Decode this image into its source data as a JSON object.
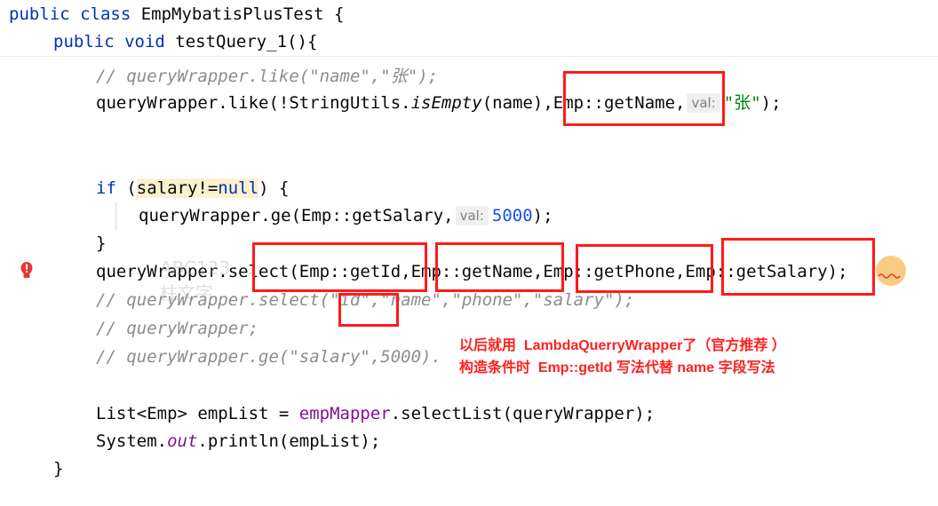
{
  "code": {
    "class_kw": "public class ",
    "class_name": "EmpMybatisPlusTest {",
    "method_mod": "public void ",
    "method_name": "testQuery_1(){",
    "c1_a": "// queryWrapper.like(\"name\",\"",
    "c1_zh": "张",
    "c1_b": "\");",
    "l2_a": "queryWrapper.like(!StringUtils.",
    "l2_isEmpty": "isEmpty",
    "l2_b": "(name),Emp::getName,",
    "l2_hint": "val:",
    "l2_str": "\"张\"",
    "l2_end": ");",
    "if_kw": "if",
    "if_open": " (",
    "if_var": "salary!=",
    "if_null": "null",
    "if_close": ") {",
    "ge_a": "queryWrapper.ge(Emp::getSalary,",
    "ge_hint": "val:",
    "ge_num": "5000",
    "ge_end": ");",
    "brace_close": "}",
    "select_line": "queryWrapper.select(Emp::getId,Emp::getName,Emp::getPhone,Emp::getSalary);",
    "c_select_a": "// queryWrapper.select(",
    "c_select_b": "\"id\",\"name\",\"phone\",\"salary\"",
    "c_select_c": ");",
    "c_qw": "// queryWrapper;",
    "c_ge_a": "// queryWrapper.ge(",
    "c_ge_b": "\"salary\"",
    "c_ge_c": ",5000).",
    "list_a": "List<Emp> empList = ",
    "list_mapper": "empMapper",
    "list_b": ".selectList(queryWrapper);",
    "sys_a": "System.",
    "sys_out": "out",
    "sys_b": ".println(empList);",
    "end_brace": "}"
  },
  "annotation": {
    "line1": "以后就用  LambdaQuerryWrapper了（官方推荐 ）",
    "line2": "构造条件时  Emp::getId 写法代替 name 字段写法"
  },
  "watermark": "ABC123 ...\n柱文字",
  "colors": {
    "highlight_box": "#ff1a1a",
    "annotation": "#ff2020"
  }
}
